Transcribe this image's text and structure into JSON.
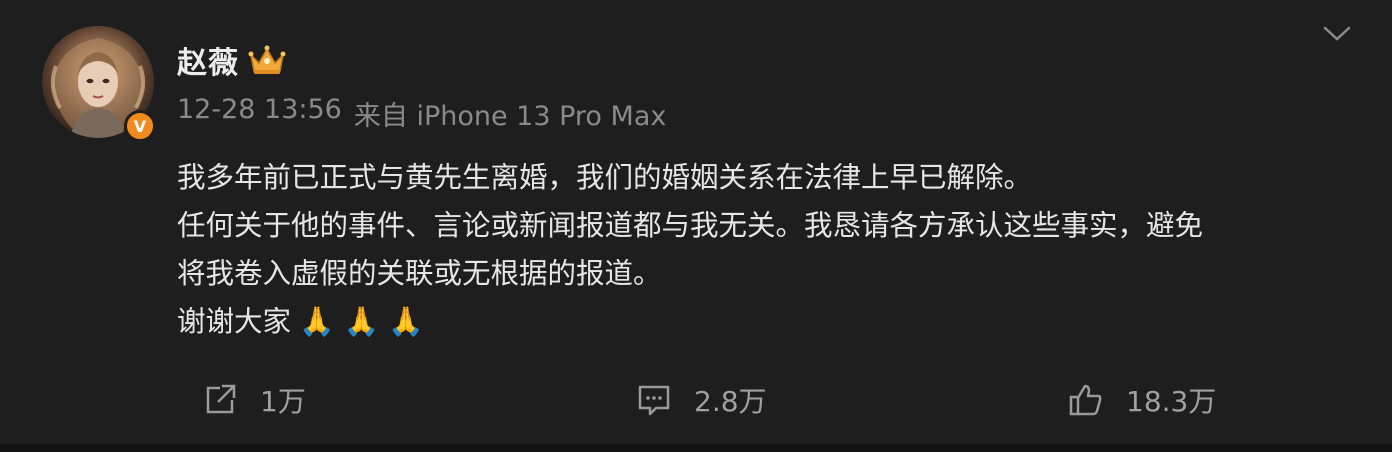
{
  "post": {
    "author": "赵薇",
    "time": "12-28 13:56",
    "source": "来自 iPhone 13 Pro Max",
    "verified_badge": "V",
    "content_lines": [
      "我多年前已正式与黄先生离婚，我们的婚姻关系在法律上早已解除。",
      "任何关于他的事件、言论或新闻报道都与我无关。我恳请各方承认这些事实，避免",
      "将我卷入虚假的关联或无根据的报道。",
      "谢谢大家"
    ],
    "emoji": "🙏 🙏 🙏"
  },
  "actions": {
    "repost": {
      "icon": "share-icon",
      "count": "1万"
    },
    "comment": {
      "icon": "comment-icon",
      "count": "2.8万"
    },
    "like": {
      "icon": "thumbs-up-icon",
      "count": "18.3万"
    }
  },
  "icons": {
    "member": "crown-icon",
    "menu": "chevron-down-icon"
  },
  "colors": {
    "background": "#1e1e1e",
    "badge": "#f28a1e",
    "meta_text": "#8a8a8a"
  }
}
